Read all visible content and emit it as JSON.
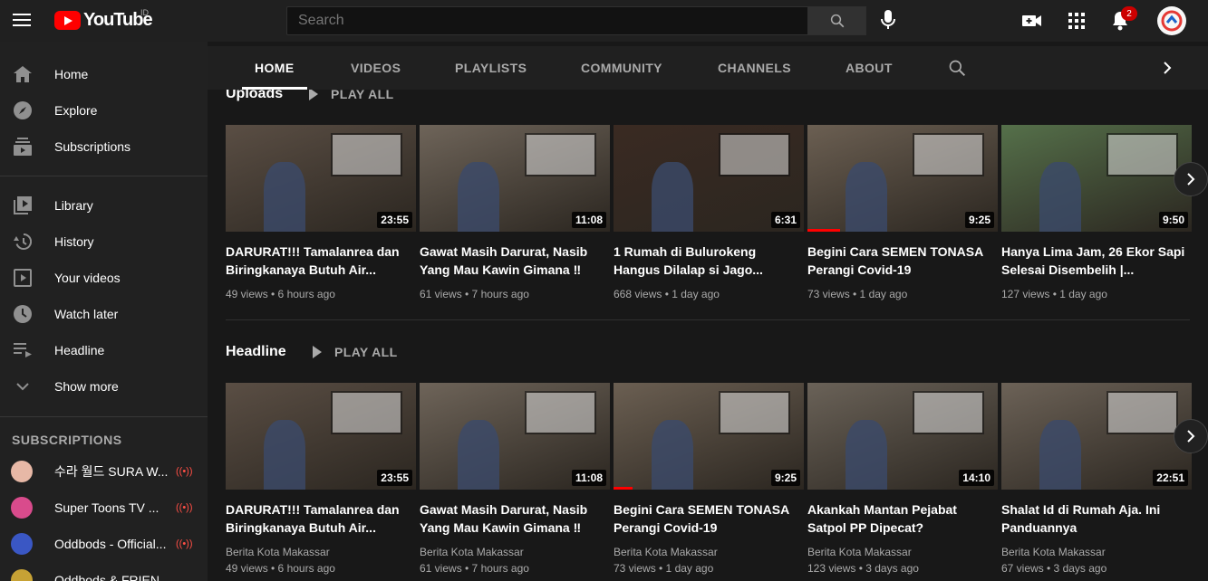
{
  "topbar": {
    "logo_text": "YouTube",
    "region": "ID",
    "search_placeholder": "Search",
    "notification_count": "2"
  },
  "sidebar": {
    "items": [
      {
        "label": "Home",
        "icon": "home-icon"
      },
      {
        "label": "Explore",
        "icon": "compass-icon"
      },
      {
        "label": "Subscriptions",
        "icon": "subscriptions-icon"
      },
      {
        "label": "Library",
        "icon": "library-icon"
      },
      {
        "label": "History",
        "icon": "history-icon"
      },
      {
        "label": "Your videos",
        "icon": "your-videos-icon"
      },
      {
        "label": "Watch later",
        "icon": "clock-icon"
      },
      {
        "label": "Headline",
        "icon": "playlist-icon"
      },
      {
        "label": "Show more",
        "icon": "chevron-down-icon"
      }
    ],
    "subscriptions_heading": "SUBSCRIPTIONS",
    "subscriptions": [
      {
        "name": "수라 월드 SURA W...",
        "color": "#e7b8a6"
      },
      {
        "name": "Super Toons TV ...",
        "color": "#d94b8c"
      },
      {
        "name": "Oddbods - Official...",
        "color": "#3a57c4"
      },
      {
        "name": "Oddbods & FRIEN...",
        "color": "#c7a235"
      }
    ]
  },
  "tabs": [
    "HOME",
    "VIDEOS",
    "PLAYLISTS",
    "COMMUNITY",
    "CHANNELS",
    "ABOUT"
  ],
  "shelves": [
    {
      "title": "Uploads",
      "playall": "PLAY ALL",
      "videos": [
        {
          "title": "DARURAT!!! Tamalanrea dan Biringkanaya Butuh Air...",
          "duration": "23:55",
          "channel": "",
          "meta": "49 views • 6 hours ago",
          "bg": "#5a4e44",
          "progress": 0
        },
        {
          "title": "Gawat Masih Darurat, Nasib Yang Mau Kawin Gimana ‼",
          "duration": "11:08",
          "channel": "",
          "meta": "61 views • 7 hours ago",
          "bg": "#6e6459",
          "progress": 0
        },
        {
          "title": "1 Rumah di Bulurokeng Hangus Dilalap si Jago...",
          "duration": "6:31",
          "channel": "",
          "meta": "668 views • 1 day ago",
          "bg": "#3a2a22",
          "progress": 0
        },
        {
          "title": "Begini Cara SEMEN TONASA Perangi Covid-19",
          "duration": "9:25",
          "channel": "",
          "meta": "73 views • 1 day ago",
          "bg": "#6b5f52",
          "progress": 0.17
        },
        {
          "title": "Hanya Lima Jam, 26 Ekor Sapi Selesai Disembelih |...",
          "duration": "9:50",
          "channel": "",
          "meta": "127 views • 1 day ago",
          "bg": "#55704a",
          "progress": 0
        }
      ]
    },
    {
      "title": "Headline",
      "playall": "PLAY ALL",
      "videos": [
        {
          "title": "DARURAT!!! Tamalanrea dan Biringkanaya Butuh Air...",
          "duration": "23:55",
          "channel": "Berita Kota Makassar",
          "meta": "49 views • 6 hours ago",
          "bg": "#5a4e44",
          "progress": 0
        },
        {
          "title": "Gawat Masih Darurat, Nasib Yang Mau Kawin Gimana ‼",
          "duration": "11:08",
          "channel": "Berita Kota Makassar",
          "meta": "61 views • 7 hours ago",
          "bg": "#6e6459",
          "progress": 0
        },
        {
          "title": "Begini Cara SEMEN TONASA Perangi Covid-19",
          "duration": "9:25",
          "channel": "Berita Kota Makassar",
          "meta": "73 views • 1 day ago",
          "bg": "#6b5f52",
          "progress": 0.1
        },
        {
          "title": "Akankah Mantan Pejabat Satpol PP Dipecat?",
          "duration": "14:10",
          "channel": "Berita Kota Makassar",
          "meta": "123 views • 3 days ago",
          "bg": "#6a6258",
          "progress": 0
        },
        {
          "title": "Shalat Id di Rumah Aja. Ini Panduannya",
          "duration": "22:51",
          "channel": "Berita Kota Makassar",
          "meta": "67 views • 3 days ago",
          "bg": "#6c6257",
          "progress": 0
        }
      ]
    }
  ],
  "colors": {
    "accent": "#ff0000",
    "bg": "#181818",
    "sidebar": "#212121"
  }
}
